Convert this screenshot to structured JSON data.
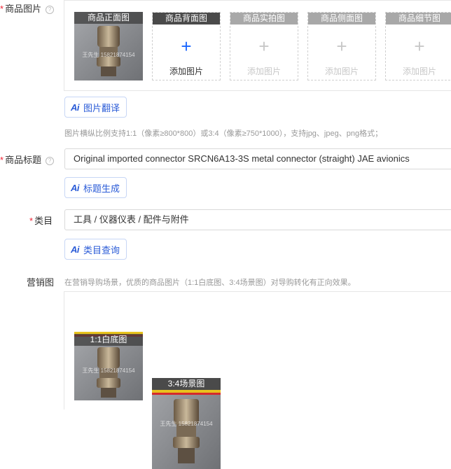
{
  "product_images": {
    "label": "商品图片",
    "help": "?",
    "slots": [
      {
        "title": "商品正面图",
        "filled": true
      },
      {
        "title": "商品背面图",
        "action": "添加图片",
        "active": true
      },
      {
        "title": "商品实拍图",
        "action": "添加图片",
        "active": false
      },
      {
        "title": "商品侧面图",
        "action": "添加图片",
        "active": false
      },
      {
        "title": "商品细节图",
        "action": "添加图片",
        "active": false
      }
    ],
    "watermark": "王先生 15821874154",
    "translate_button": "图片翻译",
    "hint": "图片横纵比例支持1:1（像素≥800*800）或3:4（像素≥750*1000），支持jpg、jpeg、png格式；"
  },
  "title_field": {
    "label": "商品标题",
    "help": "?",
    "value": "Original imported connector SRCN6A13-3S metal connector (straight) JAE avionics",
    "generate_button": "标题生成"
  },
  "category": {
    "label": "类目",
    "value": "工具 / 仪器仪表 / 配件与附件",
    "query_button": "类目查询"
  },
  "marketing": {
    "label": "营销图",
    "hint": "在营销导购场景，优质的商品图片（1:1白底图、3:4场景图）对导购转化有正向效果。",
    "images": [
      {
        "title": "1:1白底图"
      },
      {
        "title": "3:4场景图"
      }
    ]
  },
  "ai_mark": "Ai",
  "colors": {
    "accent": "#2a5bd7",
    "required": "#e23333",
    "plus": "#1a66ff"
  }
}
